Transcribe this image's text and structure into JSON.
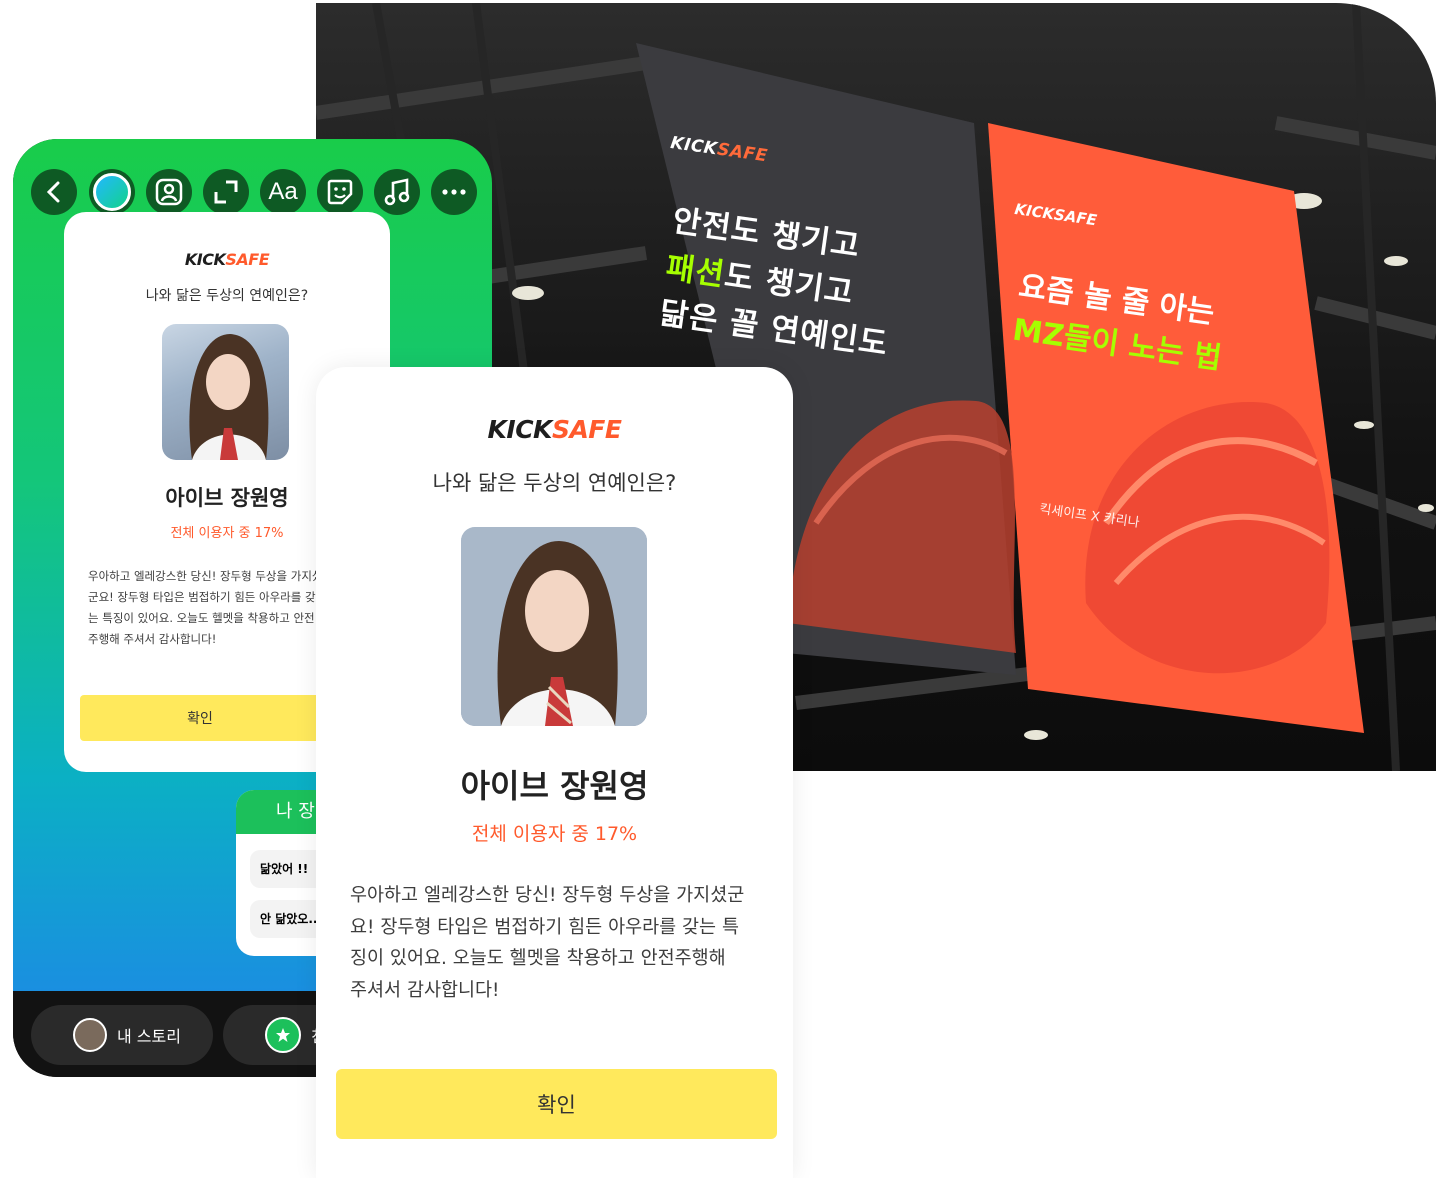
{
  "banner": {
    "dark": {
      "brand_kick": "KICK",
      "brand_safe": "SAFE",
      "line1": "안전도 챙기고",
      "line2_highlight": "패션",
      "line2_rest": "도 챙기고",
      "line3": "닮은 꼴 연예인도"
    },
    "orange": {
      "brand_kick": "KICK",
      "brand_safe": "SAFE",
      "line1": "요즘 놀 줄 아는",
      "line2": "MZ들이 노는 법",
      "collab": "킥세이프 X 카리나"
    }
  },
  "story": {
    "toolbar_icons": [
      "back-icon",
      "color-picker-icon",
      "portrait-icon",
      "resize-icon",
      "text-icon",
      "sticker-icon",
      "music-icon",
      "more-icon"
    ],
    "text_tool_label": "Aa",
    "card": {
      "brand_kick": "KICK",
      "brand_safe": "SAFE",
      "question": "나와 닮은 두상의 연예인은?",
      "name": "아이브 장원영",
      "percent": "전체 이용자 중 17%",
      "desc": "우아하고 엘레강스한 당신! 장두형 두상을 가지셨군요! 장두형 타입은 범접하기 힘든 아우라를 갖는 특징이 있어요. 오늘도 헬멧을 착용하고 안전주행해 주셔서 감사합니다!",
      "confirm": "확인"
    },
    "poll": {
      "title": "나 장",
      "option1": "닮았어 !!",
      "option2": "안 닮았오..."
    },
    "bottom": {
      "my_story": "내 스토리",
      "friends": "친"
    }
  },
  "result": {
    "brand_kick": "KICK",
    "brand_safe": "SAFE",
    "question": "나와 닮은 두상의 연예인은?",
    "name": "아이브 장원영",
    "percent": "전체 이용자 중 17%",
    "desc_lines": [
      "우아하고 엘레강스한 당신! 장두형 두상을 가지셨군",
      "요! 장두형 타입은 범접하기 힘든 아우라를 갖는 특",
      "징이 있어요. 오늘도 헬멧을 착용하고 안전주행해",
      "주셔서 감사합니다!"
    ],
    "confirm": "확인"
  },
  "colors": {
    "accent_orange": "#ff5a2c",
    "highlight_green": "#a6ff00",
    "button_yellow": "#ffe95c",
    "story_green": "#19cc4a",
    "story_blue": "#1a8fe0"
  }
}
